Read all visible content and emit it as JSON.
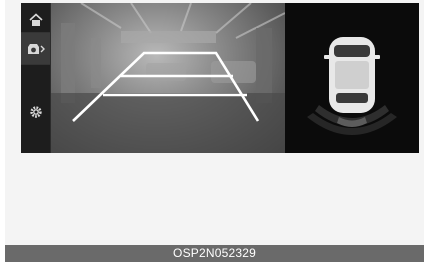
{
  "sidebar": {
    "items": [
      {
        "icon": "home-icon"
      },
      {
        "icon": "camera-view-icon",
        "active": true
      },
      {
        "icon": "settings-icon"
      }
    ]
  },
  "camera_view": {
    "guide_color": "#ffffff",
    "guide_lines": "static-trajectory"
  },
  "parking_sensor": {
    "vehicle_color": "#e8e8e8",
    "zones": "rear-zones-active"
  },
  "caption": {
    "code": "OSP2N052329"
  }
}
